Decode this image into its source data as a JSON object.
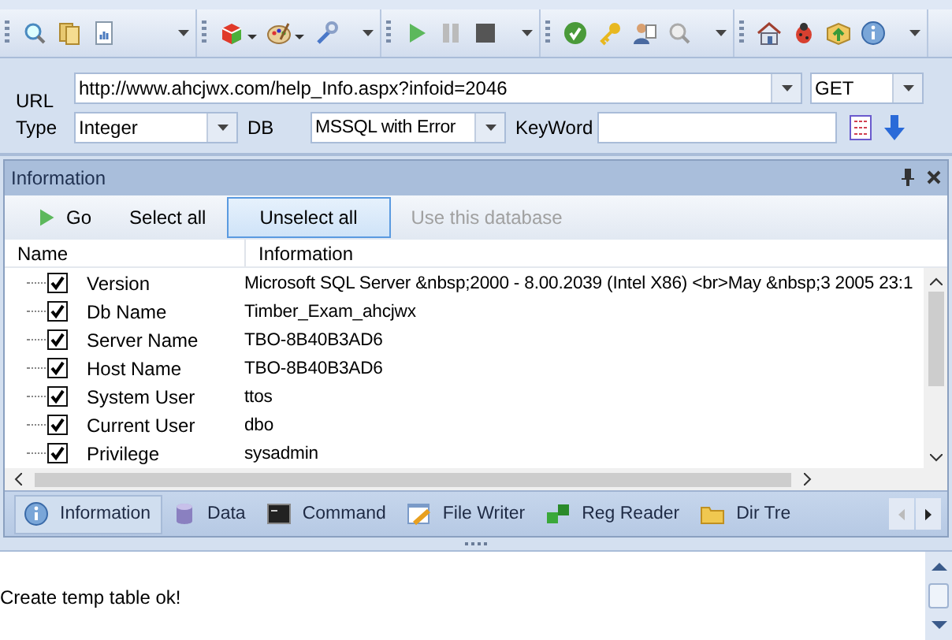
{
  "form": {
    "url": {
      "label": "URL",
      "value": "http://www.ahcjwx.com/help_Info.aspx?infoid=2046"
    },
    "method": {
      "value": "GET"
    },
    "type": {
      "label": "Type",
      "value": "Integer"
    },
    "db": {
      "label": "DB",
      "value": "MSSQL with Error"
    },
    "keyword": {
      "label": "KeyWord"
    }
  },
  "panel": {
    "title": "Information",
    "actions": [
      {
        "label": "Go",
        "kind": "go",
        "selected": false,
        "disabled": false
      },
      {
        "label": "Select all",
        "kind": "plain",
        "selected": false,
        "disabled": false
      },
      {
        "label": "Unselect all",
        "kind": "plain",
        "selected": true,
        "disabled": false
      },
      {
        "label": "Use this database",
        "kind": "plain",
        "selected": false,
        "disabled": true
      }
    ],
    "columns": [
      "Name",
      "Information"
    ],
    "rows": [
      {
        "name": "Version",
        "info": "Microsoft SQL Server &nbsp;2000 - 8.00.2039 (Intel X86) <br>May &nbsp;3 2005 23:1",
        "checked": true
      },
      {
        "name": "Db Name",
        "info": "Timber_Exam_ahcjwx",
        "checked": true
      },
      {
        "name": "Server Name",
        "info": "TBO-8B40B3AD6",
        "checked": true
      },
      {
        "name": "Host Name",
        "info": "TBO-8B40B3AD6",
        "checked": true
      },
      {
        "name": "System User",
        "info": "ttos",
        "checked": true
      },
      {
        "name": "Current User",
        "info": "dbo",
        "checked": true
      },
      {
        "name": "Privilege",
        "info": "sysadmin",
        "checked": true
      }
    ],
    "tabs": [
      {
        "label": "Information",
        "selected": true
      },
      {
        "label": "Data",
        "selected": false
      },
      {
        "label": "Command",
        "selected": false
      },
      {
        "label": "File Writer",
        "selected": false
      },
      {
        "label": "Reg Reader",
        "selected": false
      },
      {
        "label": "Dir Tre",
        "selected": false
      }
    ]
  },
  "log": {
    "lines": [
      "Create temp table ok!"
    ]
  }
}
